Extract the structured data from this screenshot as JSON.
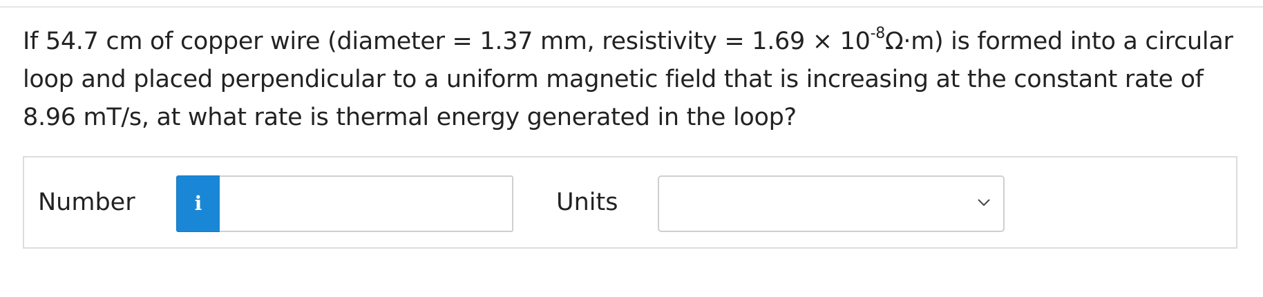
{
  "question": {
    "part1": "If 54.7 cm of copper wire (diameter = 1.37 mm, resistivity = 1.69 × 10",
    "exponent": "-8",
    "part2": "Ω·m) is formed into a circular loop and placed perpendicular to a uniform magnetic field that is increasing at the constant rate of 8.96 mT/s, at what rate is thermal energy generated in the loop?"
  },
  "answer": {
    "number_label": "Number",
    "number_value": "",
    "info_icon": "i",
    "units_label": "Units",
    "units_selected": ""
  },
  "colors": {
    "info_button": "#1a87d6",
    "border": "#cfcfcf",
    "text": "#222222"
  },
  "icons": {
    "info": "info-icon",
    "dropdown": "chevron-down-icon"
  }
}
